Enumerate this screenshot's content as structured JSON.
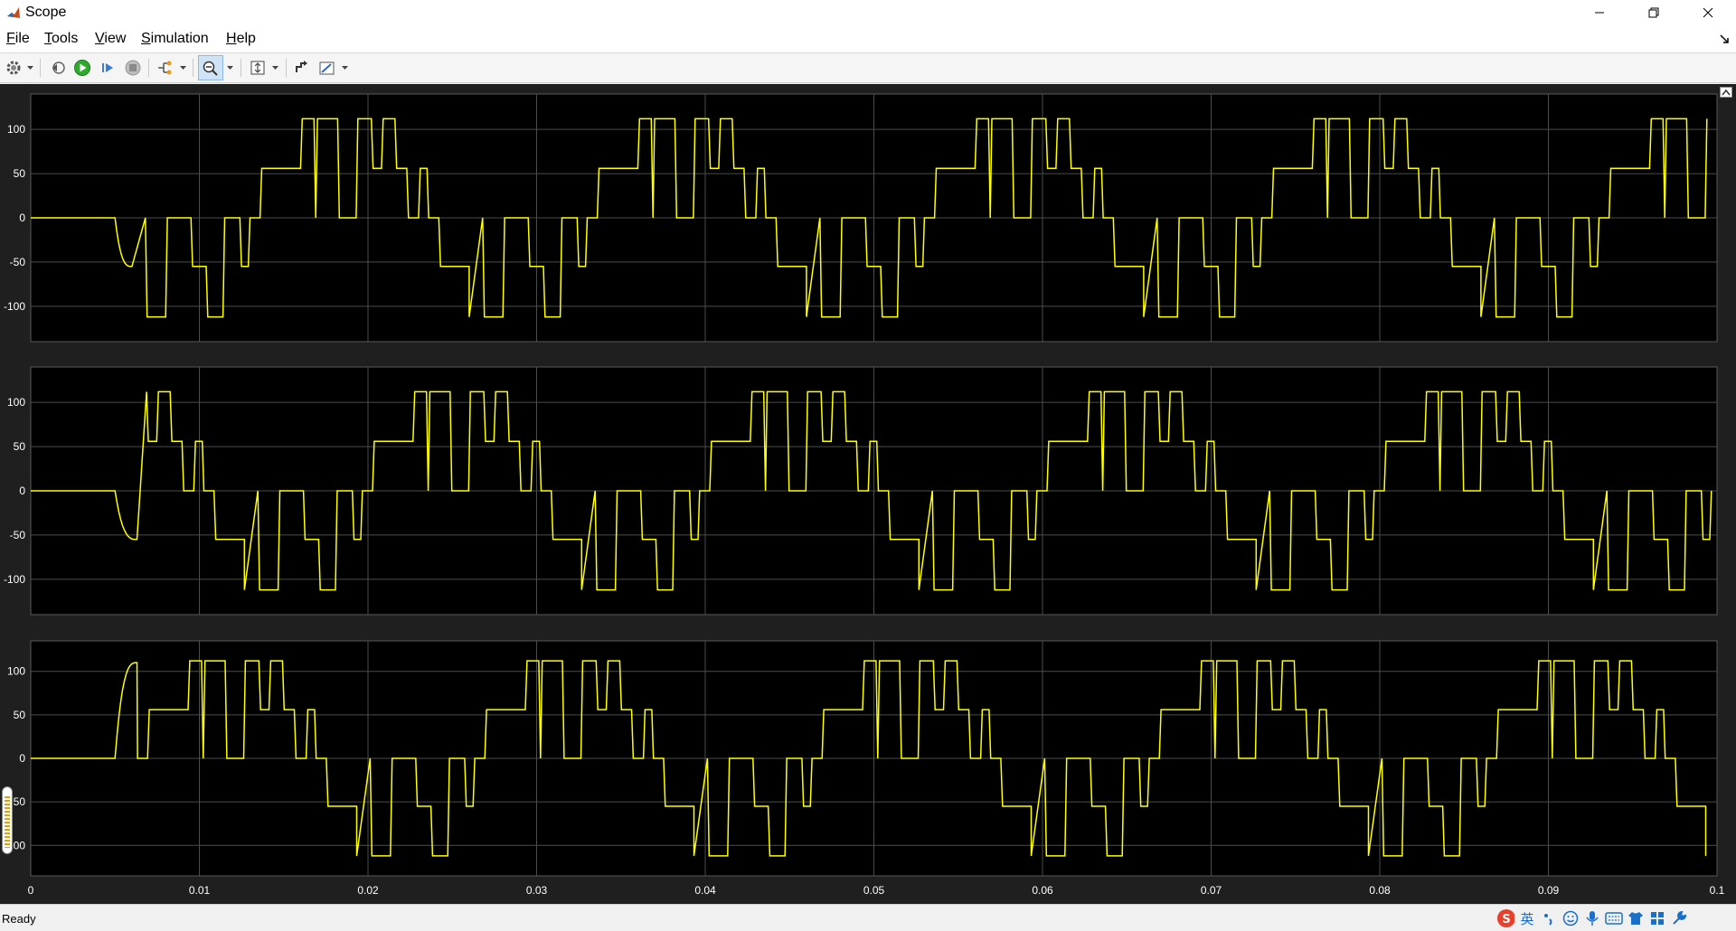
{
  "window": {
    "title": "Scope",
    "controls": [
      "minimize",
      "restore",
      "close"
    ]
  },
  "menu": {
    "items": [
      {
        "key": "F",
        "rest": "ile"
      },
      {
        "key": "T",
        "rest": "ools"
      },
      {
        "key": "V",
        "rest": "iew"
      },
      {
        "key": "S",
        "rest": "imulation"
      },
      {
        "key": "H",
        "rest": "elp"
      }
    ]
  },
  "toolbar": {
    "icons": [
      "settings-gear-icon",
      "step-back-icon",
      "run-icon",
      "step-forward-icon",
      "stop-icon",
      "signal-highlight-icon",
      "zoom-icon",
      "scale-axes-icon",
      "cursor-measurement-icon",
      "triggers-icon"
    ],
    "active": "zoom-icon"
  },
  "status": {
    "text": "Ready"
  },
  "ime": {
    "lang": "英",
    "icons": [
      "sogou-logo-icon",
      "punctuation-icon",
      "emoji-icon",
      "microphone-icon",
      "keyboard-icon",
      "clothes-icon",
      "grid-icon",
      "tools-icon"
    ]
  },
  "colors": {
    "plot_bg": "#000000",
    "figure_bg": "#1f1f1f",
    "grid": "#4d4d4d",
    "axis_border": "#5a5a5a",
    "tick_label": "#ffffff",
    "signal": "#ffff00"
  },
  "chart_data": {
    "type": "line",
    "panels": [
      {
        "ylim": [
          -140,
          140
        ],
        "yticks": [
          100,
          50,
          0,
          -50,
          -100
        ],
        "period_offset": 0,
        "initial": 0,
        "transient_to": -55,
        "transient_start": 0.005,
        "transient_end": 0.006
      },
      {
        "ylim": [
          -140,
          140
        ],
        "yticks": [
          100,
          50,
          0,
          -50,
          -100
        ],
        "period_offset": 0.00667,
        "initial": 0,
        "transient_to": -55,
        "transient_start": 0.005,
        "transient_end": 0.0063
      },
      {
        "ylim": [
          -135,
          135
        ],
        "yticks": [
          100,
          50,
          0,
          -50,
          -100
        ],
        "period_offset": 0.01333,
        "initial": 0,
        "transient_to": 110,
        "transient_start": 0.005,
        "transient_end": 0.0063
      }
    ],
    "x": {
      "lim": [
        0,
        0.1
      ],
      "ticks": [
        0,
        0.01,
        0.02,
        0.03,
        0.04,
        0.05,
        0.06,
        0.07,
        0.08,
        0.09,
        0.1
      ],
      "tick_labels": [
        "0",
        "0.01",
        "0.02",
        "0.03",
        "0.04",
        "0.05",
        "0.06",
        "0.07",
        "0.08",
        "0.09",
        "0.1"
      ]
    },
    "waveform": {
      "start_time": 0.006,
      "period": 0.02,
      "levels": [
        {
          "t": 0.0,
          "v": -112
        },
        {
          "t": 0.0008,
          "v": 0
        },
        {
          "t": 0.0009,
          "v": -112
        },
        {
          "t": 0.002,
          "v": -112
        },
        {
          "t": 0.0021,
          "v": 0
        },
        {
          "t": 0.0035,
          "v": 0
        },
        {
          "t": 0.0036,
          "v": -55
        },
        {
          "t": 0.0044,
          "v": -55
        },
        {
          "t": 0.0045,
          "v": -112
        },
        {
          "t": 0.0054,
          "v": -112
        },
        {
          "t": 0.0055,
          "v": 0
        },
        {
          "t": 0.0064,
          "v": 0
        },
        {
          "t": 0.0065,
          "v": -55
        },
        {
          "t": 0.0069,
          "v": -55
        },
        {
          "t": 0.007,
          "v": 0
        },
        {
          "t": 0.0076,
          "v": 0
        },
        {
          "t": 0.0077,
          "v": 56
        },
        {
          "t": 0.01,
          "v": 56
        },
        {
          "t": 0.0101,
          "v": 112
        },
        {
          "t": 0.0108,
          "v": 112
        },
        {
          "t": 0.0109,
          "v": 0
        },
        {
          "t": 0.011,
          "v": 112
        },
        {
          "t": 0.0122,
          "v": 112
        },
        {
          "t": 0.0123,
          "v": 0
        },
        {
          "t": 0.0133,
          "v": 0
        },
        {
          "t": 0.0134,
          "v": 112
        },
        {
          "t": 0.0142,
          "v": 112
        },
        {
          "t": 0.0143,
          "v": 56
        },
        {
          "t": 0.0148,
          "v": 56
        },
        {
          "t": 0.0149,
          "v": 112
        },
        {
          "t": 0.0156,
          "v": 112
        },
        {
          "t": 0.0157,
          "v": 56
        },
        {
          "t": 0.0163,
          "v": 56
        },
        {
          "t": 0.0164,
          "v": 0
        },
        {
          "t": 0.017,
          "v": 0
        },
        {
          "t": 0.0171,
          "v": 56
        },
        {
          "t": 0.0175,
          "v": 56
        },
        {
          "t": 0.0176,
          "v": 0
        },
        {
          "t": 0.0182,
          "v": 0
        },
        {
          "t": 0.0183,
          "v": -55
        },
        {
          "t": 0.02,
          "v": -55
        }
      ]
    }
  }
}
